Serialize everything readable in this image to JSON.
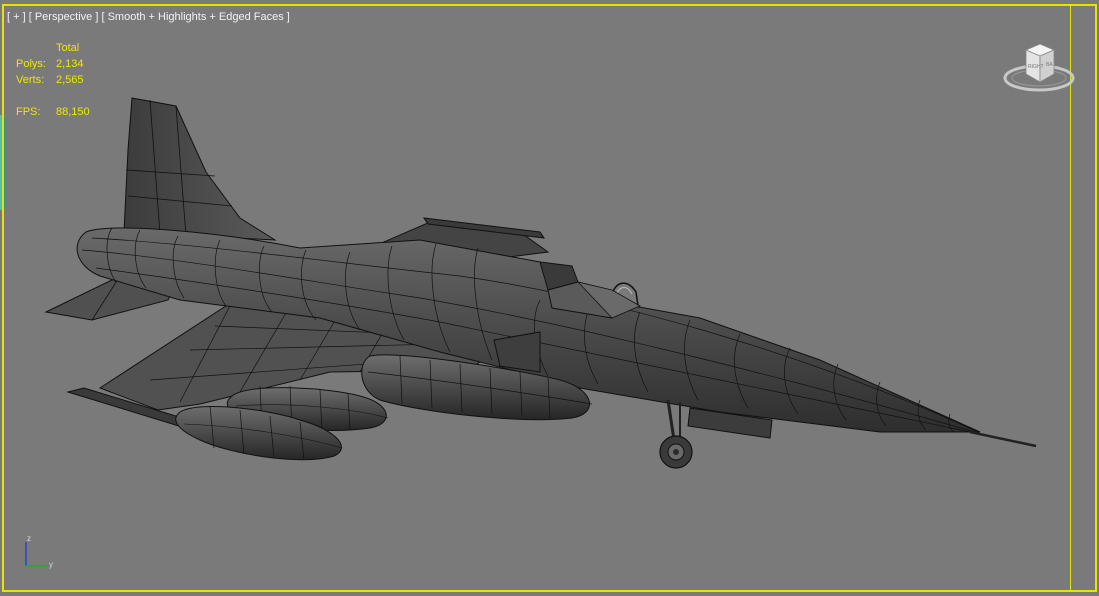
{
  "viewport": {
    "label_plus": "[ + ]",
    "label_view": "[ Perspective ]",
    "label_shading": "[ Smooth + Highlights + Edged Faces ]"
  },
  "stats": {
    "header": "Total",
    "polys_label": "Polys:",
    "polys_value": "2,134",
    "verts_label": "Verts:",
    "verts_value": "2,565",
    "fps_label": "FPS:",
    "fps_value": "88,150"
  },
  "viewcube": {
    "face_right": "RIGHT",
    "face_back": "BA"
  },
  "axis": {
    "z": "z",
    "y": "y"
  },
  "colors": {
    "viewport_bg": "#7a7a7a",
    "active_border": "#e8e400",
    "stats_text": "#f0e600",
    "model_fill": "#4e4e4e",
    "wire": "#111111"
  },
  "icons": {
    "viewcube": "viewcube-icon",
    "axis": "axis-tripod-icon"
  }
}
